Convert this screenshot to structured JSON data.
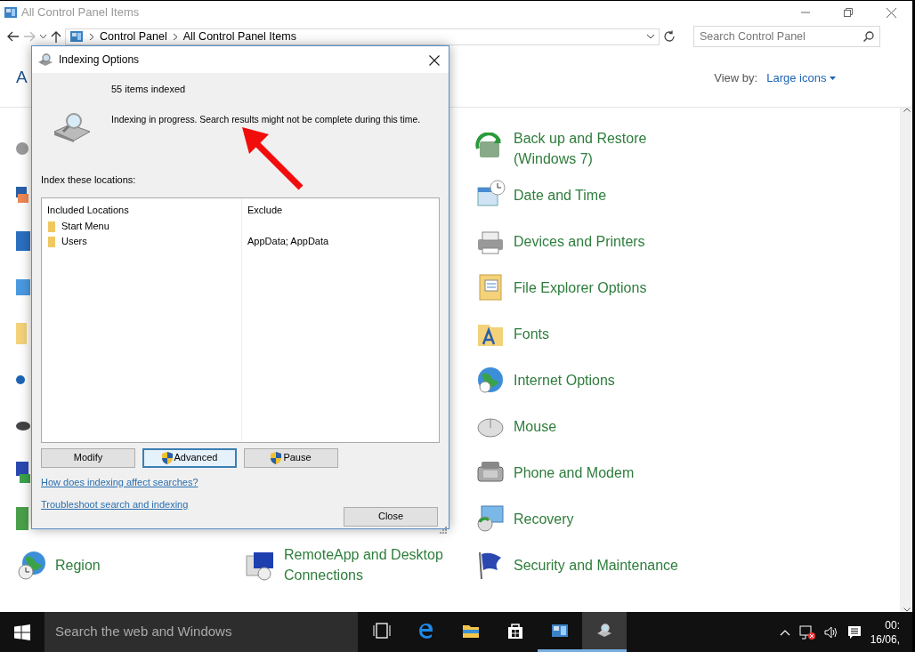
{
  "window": {
    "title": "All Control Panel Items"
  },
  "address_bar": {
    "breadcrumbs": [
      "Control Panel",
      "All Control Panel Items"
    ],
    "search_placeholder": "Search Control Panel"
  },
  "header": {
    "title": "A",
    "view_by_label": "View by:",
    "view_by_value": "Large icons"
  },
  "items": [
    {
      "label": "Back up and Restore (Windows 7)"
    },
    {
      "label": "Date and Time"
    },
    {
      "label": "Devices and Printers"
    },
    {
      "label": "File Explorer Options"
    },
    {
      "label": "Fonts"
    },
    {
      "label": "Internet Options"
    },
    {
      "label": "Mouse"
    },
    {
      "label": "Phone and Modem"
    },
    {
      "label": "Recovery"
    },
    {
      "label": "Security and Maintenance"
    }
  ],
  "bottom_row": [
    {
      "label": "Region"
    },
    {
      "label": "RemoteApp and Desktop Connections"
    }
  ],
  "dialog": {
    "title": "Indexing Options",
    "items_indexed": "55 items indexed",
    "status": "Indexing in progress. Search results might not be complete during this time.",
    "locations_label": "Index these locations:",
    "columns": [
      "Included Locations",
      "Exclude"
    ],
    "rows": [
      {
        "location": "Start Menu"
      },
      {
        "location": "Users",
        "exclude": "AppData; AppData"
      }
    ],
    "buttons": [
      {
        "label": "Modify",
        "shield": false,
        "focused": false
      },
      {
        "label": "Advanced",
        "shield": true,
        "focused": true
      },
      {
        "label": "Pause",
        "shield": true,
        "focused": false
      }
    ],
    "links": [
      "How does indexing affect searches?",
      "Troubleshoot search and indexing"
    ],
    "close_button": "Close"
  },
  "taskbar": {
    "search_placeholder": "Search the web and Windows",
    "apps": [
      {
        "kind": "task-view",
        "running": false,
        "selected": false
      },
      {
        "kind": "edge",
        "running": false,
        "selected": false
      },
      {
        "kind": "explorer",
        "running": false,
        "selected": false
      },
      {
        "kind": "store",
        "running": false,
        "selected": false
      },
      {
        "kind": "control-panel",
        "running": true,
        "selected": false
      },
      {
        "kind": "indexing",
        "running": true,
        "selected": true
      }
    ],
    "clock": [
      "00:",
      "16/06,"
    ]
  }
}
